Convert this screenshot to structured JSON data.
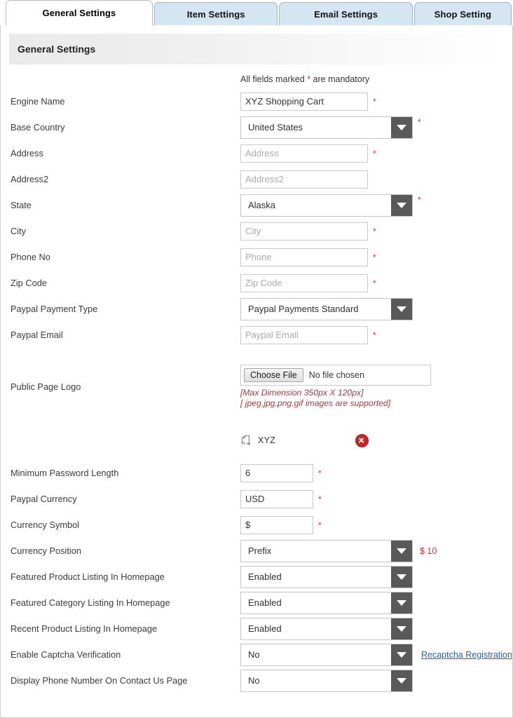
{
  "tabs": [
    {
      "label": "General Settings",
      "active": true
    },
    {
      "label": "Item Settings",
      "active": false
    },
    {
      "label": "Email Settings",
      "active": false
    },
    {
      "label": "Shop Setting",
      "active": false
    }
  ],
  "panel": {
    "header_title": "General Settings",
    "mandatory_note_prefix": "All fields marked ",
    "mandatory_note_star": "*",
    "mandatory_note_suffix": " are mandatory"
  },
  "fields": {
    "engine_name": {
      "label": "Engine Name",
      "value": "XYZ Shopping Cart",
      "required_mark": "*"
    },
    "base_country": {
      "label": "Base Country",
      "value": "United States",
      "required_mark": "*"
    },
    "address": {
      "label": "Address",
      "placeholder": "Address",
      "value": "",
      "required_mark": "*"
    },
    "address2": {
      "label": "Address2",
      "placeholder": "Address2",
      "value": ""
    },
    "state": {
      "label": "State",
      "value": "Alaska",
      "required_mark": "*"
    },
    "city": {
      "label": "City",
      "placeholder": "City",
      "value": "",
      "required_mark": "*"
    },
    "phone_no": {
      "label": "Phone No",
      "placeholder": "Phone",
      "value": "",
      "required_mark": "*"
    },
    "zip_code": {
      "label": "Zip Code",
      "placeholder": "Zip Code",
      "value": "",
      "required_mark": "*"
    },
    "paypal_payment_type": {
      "label": "Paypal Payment Type",
      "value": "Paypal Payments Standard"
    },
    "paypal_email": {
      "label": "Paypal Email",
      "placeholder": "Paypal Email",
      "value": "",
      "required_mark": "*"
    },
    "public_page_logo": {
      "label": "Public Page Logo",
      "choose_file_button": "Choose File",
      "file_status": "No file chosen",
      "hint_line1": "[Max Dimension 350px X 120px]",
      "hint_line2": "[ jpeg,jpg,png,gif images are supported]",
      "preview_alt_text": "XYZ"
    },
    "minimum_password_length": {
      "label": "Minimum Password Length",
      "value": "6",
      "required_mark": "*"
    },
    "paypal_currency": {
      "label": "Paypal Currency",
      "value": "USD",
      "required_mark": "*"
    },
    "currency_symbol": {
      "label": "Currency Symbol",
      "value": "$",
      "required_mark": "*"
    },
    "currency_position": {
      "label": "Currency Position",
      "value": "Prefix",
      "preview": "$ 10"
    },
    "featured_product_listing": {
      "label": "Featured Product Listing In Homepage",
      "value": "Enabled"
    },
    "featured_category_listing": {
      "label": "Featured Category Listing In Homepage",
      "value": "Enabled"
    },
    "recent_product_listing": {
      "label": "Recent Product Listing In Homepage",
      "value": "Enabled"
    },
    "enable_captcha": {
      "label": "Enable Captcha Verification",
      "value": "No",
      "link_label": "Recaptcha Registration"
    },
    "display_phone_number": {
      "label": "Display Phone Number On Contact Us Page",
      "value": "No"
    }
  },
  "colors": {
    "required_red": "#e12b2b",
    "hint_red": "#a33a3a",
    "link_blue": "#1f5fbf",
    "tab_inactive": "#d5e6f3",
    "dropdown_button": "#595959"
  }
}
